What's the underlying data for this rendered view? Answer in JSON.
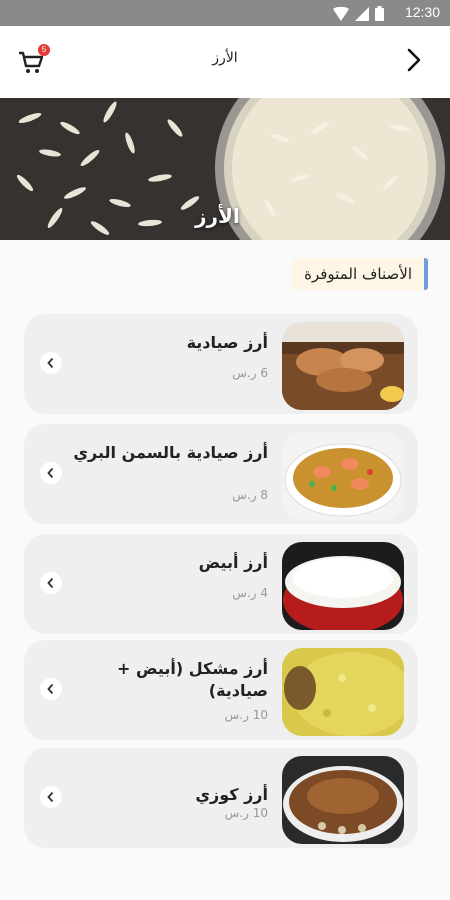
{
  "status_bar": {
    "time": "12:30"
  },
  "header": {
    "title": "الأرز",
    "cart_count": "5"
  },
  "banner": {
    "label": "الأرز"
  },
  "section": {
    "title": "الأصناف المتوفرة"
  },
  "items": [
    {
      "name": "أرز صيادية",
      "price": "6 ر.س"
    },
    {
      "name": "أرز صيادية بالسمن البري",
      "price": "8 ر.س"
    },
    {
      "name": "أرز أبيض",
      "price": "4 ر.س"
    },
    {
      "name": "أرز مشكل (أبيض + صيادية)",
      "price": "10 ر.س"
    },
    {
      "name": "أرز كوزي",
      "price": "10 ر.س"
    }
  ],
  "colors": {
    "accent": "#6f9fd8",
    "badge": "#e53935",
    "card": "#efefef"
  }
}
